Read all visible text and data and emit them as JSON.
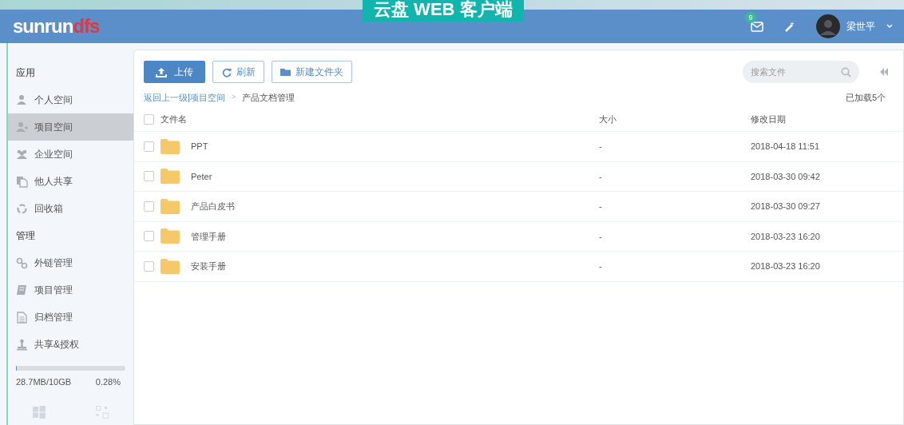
{
  "banner": "云盘 WEB 客户端",
  "header": {
    "logo_main": "sunrun",
    "logo_accent": "dfs",
    "message_count": "9",
    "user_name": "梁世平"
  },
  "sidebar": {
    "sections": [
      {
        "title": "应用",
        "items": [
          {
            "label": "个人空间",
            "kind": "person",
            "selected": false
          },
          {
            "label": "项目空间",
            "kind": "person-add",
            "selected": true
          },
          {
            "label": "企业空间",
            "kind": "group",
            "selected": false
          },
          {
            "label": "他人共享",
            "kind": "copy",
            "selected": false
          },
          {
            "label": "回收箱",
            "kind": "recycle",
            "selected": false
          }
        ]
      },
      {
        "title": "管理",
        "items": [
          {
            "label": "外链管理",
            "kind": "link",
            "selected": false
          },
          {
            "label": "项目管理",
            "kind": "book",
            "selected": false
          },
          {
            "label": "归档管理",
            "kind": "doc",
            "selected": false
          },
          {
            "label": "共享&授权",
            "kind": "stamp",
            "selected": false
          }
        ]
      }
    ],
    "storage": {
      "level": 0.0028,
      "used": "28.7MB/10GB",
      "percent": "0.28%"
    }
  },
  "toolbar": {
    "buttons": [
      {
        "label": "上传",
        "kind": "primary"
      },
      {
        "label": "刷新",
        "kind": "refresh"
      },
      {
        "label": "新建文件夹",
        "kind": "folder"
      }
    ],
    "search": {
      "placeholder": "搜索文件"
    }
  },
  "breadcrumb": {
    "back": "返回上一级",
    "parent": "项目空间",
    "separator": ">",
    "current": "产品文档管理",
    "loaded": "已加载5个"
  },
  "table": {
    "columns": [
      "文件名",
      "大小",
      "修改日期"
    ],
    "select_all": false,
    "rows": [
      {
        "name": "PPT",
        "size": "-",
        "modified": "2018-04-18 11:51",
        "checked": false
      },
      {
        "name": "Peter",
        "size": "-",
        "modified": "2018-03-30 09:42",
        "checked": false
      },
      {
        "name": "产品白皮书",
        "size": "-",
        "modified": "2018-03-30 09:27",
        "checked": false
      },
      {
        "name": "管理手册",
        "size": "-",
        "modified": "2018-03-23 16:20",
        "checked": false
      },
      {
        "name": "安装手册",
        "size": "-",
        "modified": "2018-03-23 16:20",
        "checked": false
      }
    ]
  }
}
